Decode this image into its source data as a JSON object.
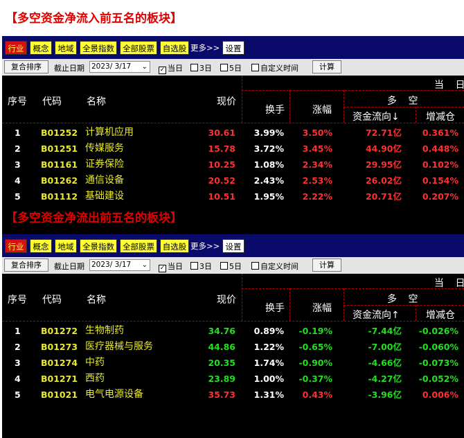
{
  "sections": [
    {
      "heading": "【多空资金净流入前五名的板块】",
      "nav": [
        "行业",
        "概念",
        "地域",
        "全景指数",
        "全部股票",
        "自选股"
      ],
      "more": "更多>>",
      "settings": "设置",
      "toolbar": {
        "sort_button": "复合排序",
        "date_label": "截止日期",
        "date_value": "2023/ 3/17",
        "opt_today": "当日",
        "opt_3day": "3日",
        "opt_5day": "5日",
        "opt_custom": "自定义时间",
        "calc_button": "计算"
      },
      "headers": {
        "idx": "序号",
        "code": "代码",
        "name": "名称",
        "price": "现价",
        "turnover": "换手",
        "change": "涨幅",
        "top_right": "当 日",
        "group": "多 空",
        "flow": "资金流向↓",
        "inc": "增减仓"
      },
      "rows": [
        {
          "idx": "1",
          "code": "B01252",
          "name": "计算机应用",
          "price": "30.61",
          "turnover": "3.99%",
          "change": "3.50%",
          "flow": "72.71亿",
          "inc": "0.361%"
        },
        {
          "idx": "2",
          "code": "B01251",
          "name": "传媒服务",
          "price": "15.78",
          "turnover": "3.72%",
          "change": "3.45%",
          "flow": "44.90亿",
          "inc": "0.448%"
        },
        {
          "idx": "3",
          "code": "B01161",
          "name": "证券保险",
          "price": "10.25",
          "turnover": "1.08%",
          "change": "2.34%",
          "flow": "29.95亿",
          "inc": "0.102%"
        },
        {
          "idx": "4",
          "code": "B01262",
          "name": "通信设备",
          "price": "20.52",
          "turnover": "2.43%",
          "change": "2.53%",
          "flow": "26.02亿",
          "inc": "0.154%"
        },
        {
          "idx": "5",
          "code": "B01112",
          "name": "基础建设",
          "price": "10.51",
          "turnover": "1.95%",
          "change": "2.22%",
          "flow": "20.71亿",
          "inc": "0.207%"
        }
      ]
    },
    {
      "heading": "【多空资金净流出前五名的板块】",
      "nav": [
        "行业",
        "概念",
        "地域",
        "全景指数",
        "全部股票",
        "自选股"
      ],
      "more": "更多>>",
      "settings": "设置",
      "toolbar": {
        "sort_button": "复合排序",
        "date_label": "截止日期",
        "date_value": "2023/ 3/17",
        "opt_today": "当日",
        "opt_3day": "3日",
        "opt_5day": "5日",
        "opt_custom": "自定义时间",
        "calc_button": "计算"
      },
      "headers": {
        "idx": "序号",
        "code": "代码",
        "name": "名称",
        "price": "现价",
        "turnover": "换手",
        "change": "涨幅",
        "top_right": "当 日",
        "group": "多 空",
        "flow": "资金流向↑",
        "inc": "增减仓"
      },
      "rows": [
        {
          "idx": "1",
          "code": "B01272",
          "name": "生物制药",
          "price": "34.76",
          "turnover": "0.89%",
          "change": "-0.19%",
          "flow": "-7.44亿",
          "inc": "-0.026%"
        },
        {
          "idx": "2",
          "code": "B01273",
          "name": "医疗器械与服务",
          "price": "44.86",
          "turnover": "1.22%",
          "change": "-0.65%",
          "flow": "-7.00亿",
          "inc": "-0.060%"
        },
        {
          "idx": "3",
          "code": "B01274",
          "name": "中药",
          "price": "20.35",
          "turnover": "1.74%",
          "change": "-0.90%",
          "flow": "-4.66亿",
          "inc": "-0.073%"
        },
        {
          "idx": "4",
          "code": "B01271",
          "name": "西药",
          "price": "23.89",
          "turnover": "1.00%",
          "change": "-0.37%",
          "flow": "-4.27亿",
          "inc": "-0.052%"
        },
        {
          "idx": "5",
          "code": "B01021",
          "name": "电气电源设备",
          "price": "35.73",
          "turnover": "1.31%",
          "change": "0.43%",
          "flow": "-3.96亿",
          "inc": "0.006%"
        }
      ]
    }
  ],
  "colors": {
    "up": "#ff3030",
    "down": "#20e020",
    "name": "#e8e830",
    "nav_bg": "#0a0a6a",
    "table_bg": "#000000"
  }
}
